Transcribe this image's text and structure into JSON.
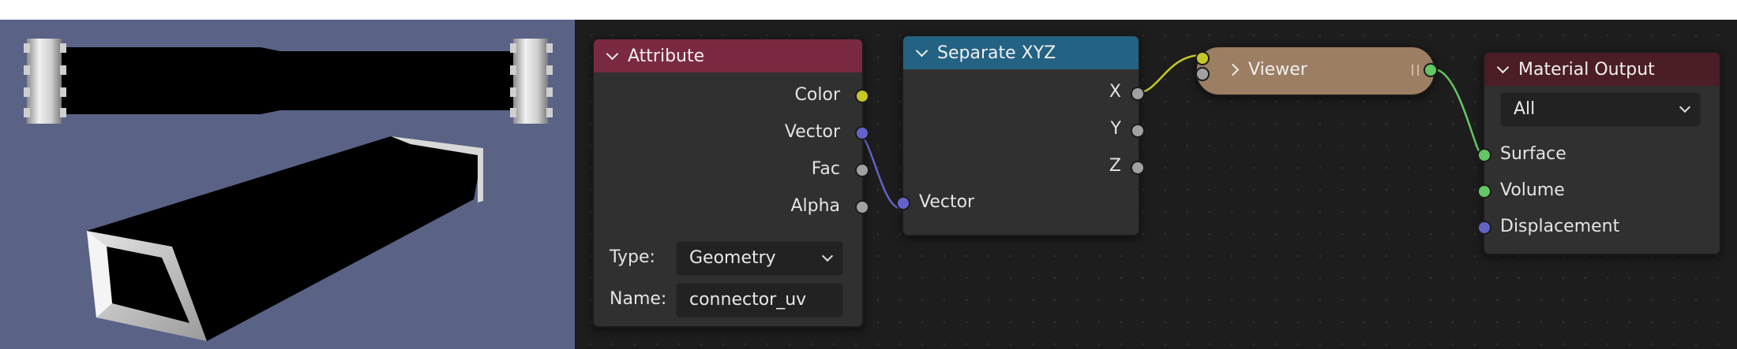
{
  "attribute_node": {
    "title": "Attribute",
    "outputs": [
      "Color",
      "Vector",
      "Fac",
      "Alpha"
    ],
    "type_label": "Type:",
    "type_value": "Geometry",
    "name_label": "Name:",
    "name_value": "connector_uv",
    "header_color": "#7a2a40"
  },
  "separate_node": {
    "title": "Separate XYZ",
    "outputs": [
      "X",
      "Y",
      "Z"
    ],
    "input": "Vector",
    "header_color": "#246283"
  },
  "viewer_node": {
    "title": "Viewer",
    "body_color": "#9c7e63"
  },
  "material_output_node": {
    "title": "Material Output",
    "target_value": "All",
    "inputs": [
      "Surface",
      "Volume",
      "Displacement"
    ],
    "header_color": "#4a1e24"
  },
  "socket_colors": {
    "color": "#c7c729",
    "vector": "#6363c7",
    "float": "#a1a1a1",
    "shader": "#63c763"
  },
  "icons": {
    "collapse": "chevron-down-icon",
    "expand": "chevron-right-icon",
    "dropdown": "chevron-down-icon"
  }
}
